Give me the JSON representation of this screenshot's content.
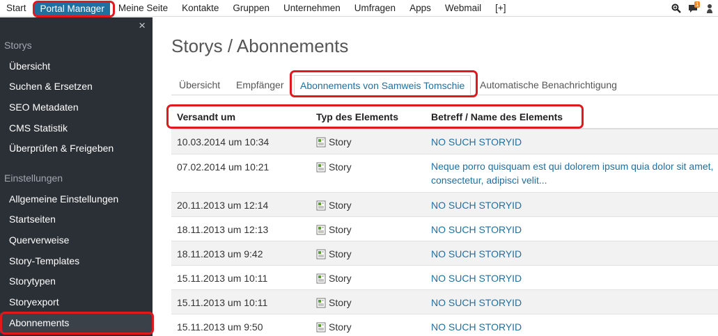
{
  "topnav": {
    "items": [
      "Start",
      "Portal Manager",
      "Meine Seite",
      "Kontakte",
      "Gruppen",
      "Unternehmen",
      "Umfragen",
      "Apps",
      "Webmail",
      "[+]"
    ],
    "badge_count": "1",
    "accent": "#1f6f9f",
    "highlight": "#e0191f"
  },
  "sidebar": {
    "close": "×",
    "sections": [
      {
        "title": "Storys",
        "items": [
          "Übersicht",
          "Suchen & Ersetzen",
          "SEO Metadaten",
          "CMS Statistik",
          "Überprüfen & Freigeben"
        ]
      },
      {
        "title": "Einstellungen",
        "items": [
          "Allgemeine Einstellungen",
          "Startseiten",
          "Querverweise",
          "Story-Templates",
          "Storytypen",
          "Storyexport",
          "Abonnements"
        ]
      }
    ],
    "active_item": "Abonnements"
  },
  "main": {
    "title": "Storys / Abonnements",
    "tabs": [
      "Übersicht",
      "Empfänger",
      "Abonnements von Samweis Tomschie",
      "Automatische Benachrichtigung"
    ],
    "active_tab": "Abonnements von Samweis Tomschie",
    "table": {
      "columns": [
        "Versandt um",
        "Typ des Elements",
        "Betreff / Name des Elements"
      ],
      "rows": [
        {
          "date": "10.03.2014 um 10:34",
          "type": "Story",
          "subject": "NO SUCH STORYID"
        },
        {
          "date": "07.02.2014 um 10:21",
          "type": "Story",
          "subject": "Neque porro quisquam est qui dolorem ipsum quia dolor sit amet, consectetur, adipisci velit..."
        },
        {
          "date": "20.11.2013 um 12:14",
          "type": "Story",
          "subject": "NO SUCH STORYID"
        },
        {
          "date": "18.11.2013 um 12:13",
          "type": "Story",
          "subject": "NO SUCH STORYID"
        },
        {
          "date": "18.11.2013 um 9:42",
          "type": "Story",
          "subject": "NO SUCH STORYID"
        },
        {
          "date": "15.11.2013 um 10:11",
          "type": "Story",
          "subject": "NO SUCH STORYID"
        },
        {
          "date": "15.11.2013 um 10:11",
          "type": "Story",
          "subject": "NO SUCH STORYID"
        },
        {
          "date": "15.11.2013 um 9:50",
          "type": "Story",
          "subject": "NO SUCH STORYID"
        }
      ]
    }
  }
}
